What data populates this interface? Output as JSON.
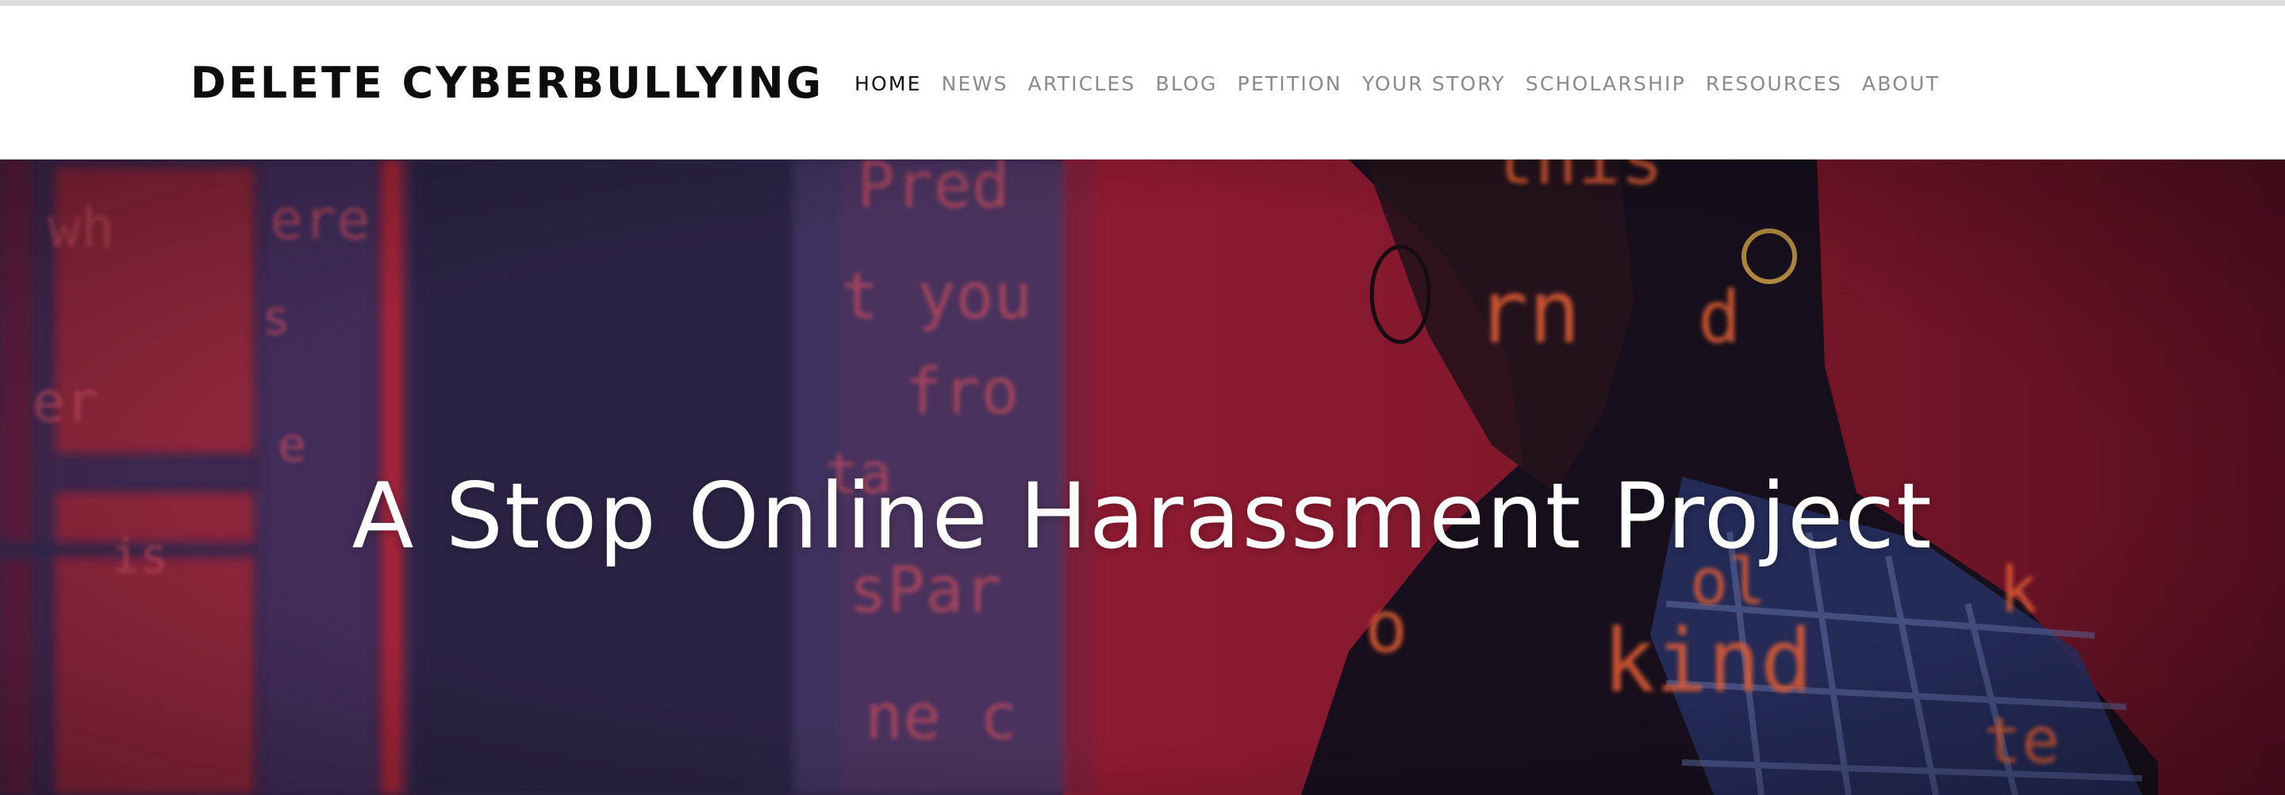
{
  "site": {
    "title": "DELETE CYBERBULLYING"
  },
  "nav": {
    "items": [
      {
        "label": "HOME",
        "active": true
      },
      {
        "label": "NEWS",
        "active": false
      },
      {
        "label": "ARTICLES",
        "active": false
      },
      {
        "label": "BLOG",
        "active": false
      },
      {
        "label": "PETITION",
        "active": false
      },
      {
        "label": "YOUR STORY",
        "active": false
      },
      {
        "label": "SCHOLARSHIP",
        "active": false
      },
      {
        "label": "RESOURCES",
        "active": false
      },
      {
        "label": "ABOUT",
        "active": false
      }
    ]
  },
  "hero": {
    "title": "A Stop Online Harassment Project",
    "image": "woman-with-projected-text-photo"
  },
  "colors": {
    "nav_active": "#111111",
    "nav_inactive": "#8a8a8a",
    "hero_red": "#b3233c",
    "hero_purple": "#3b2a55"
  }
}
